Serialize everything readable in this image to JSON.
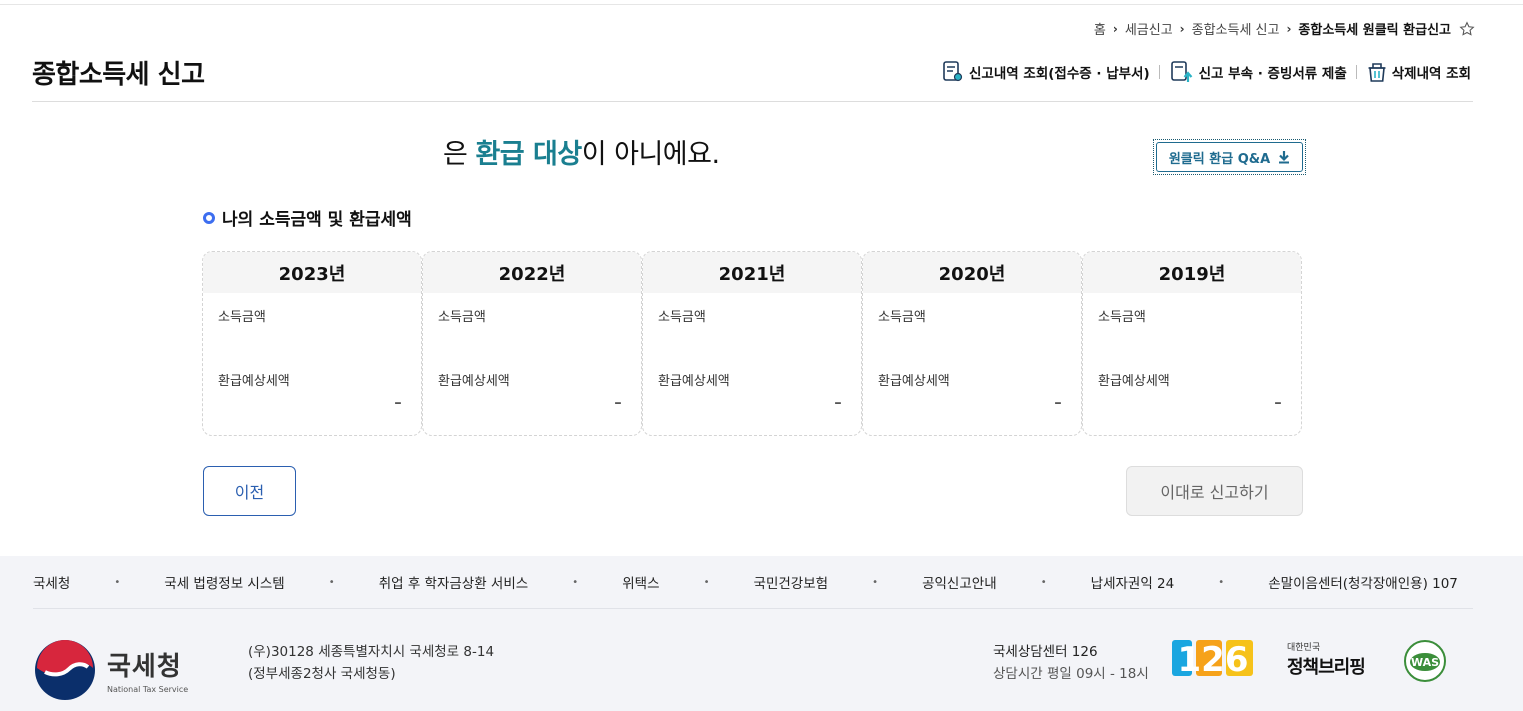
{
  "breadcrumb": {
    "items": [
      "홈",
      "세금신고",
      "종합소득세 신고"
    ],
    "current": "종합소득세 원클릭 환급신고"
  },
  "header": {
    "title": "종합소득세 신고",
    "links": [
      "신고내역 조회(접수증 · 납부서)",
      "신고 부속 · 증빙서류 제출",
      "삭제내역 조회"
    ]
  },
  "result": {
    "prefix": "은 ",
    "highlight": "환급 대상",
    "suffix": "이 아니에요."
  },
  "qa_button": {
    "label": "원클릭 환급 Q&A"
  },
  "section": {
    "title": "나의 소득금액 및 환급세액"
  },
  "cards": [
    {
      "year": "2023년",
      "income_label": "소득금액",
      "refund_label": "환급예상세액",
      "refund_value": "-"
    },
    {
      "year": "2022년",
      "income_label": "소득금액",
      "refund_label": "환급예상세액",
      "refund_value": "-"
    },
    {
      "year": "2021년",
      "income_label": "소득금액",
      "refund_label": "환급예상세액",
      "refund_value": "-"
    },
    {
      "year": "2020년",
      "income_label": "소득금액",
      "refund_label": "환급예상세액",
      "refund_value": "-"
    },
    {
      "year": "2019년",
      "income_label": "소득금액",
      "refund_label": "환급예상세액",
      "refund_value": "-"
    }
  ],
  "buttons": {
    "prev": "이전",
    "submit": "이대로 신고하기"
  },
  "footer": {
    "links": [
      "국세청",
      "국세 법령정보 시스템",
      "취업 후 학자금상환 서비스",
      "위택스",
      "국민건강보험",
      "공익신고안내",
      "납세자권익 24",
      "손말이음센터(청각장애인용) 107"
    ],
    "bullet": "•",
    "logo_name": "국세청",
    "logo_sub": "National Tax Service",
    "address_line1": "(우)30128 세종특별자치시 국세청로 8-14",
    "address_line2": "(정부세종2청사 국세청동)",
    "center_name": "국세상담센터 126",
    "center_hours": "상담시간 평일 09시 - 18시",
    "badge_number": "126",
    "policy_small": "대한민국",
    "policy_big": "정책브리핑",
    "was_label": "WAS"
  },
  "colors": {
    "accent_teal": "#1a7f90",
    "button_blue": "#2b5fb0",
    "qa_blue": "#1f6b8f",
    "footer_bg": "#f3f4f8"
  }
}
